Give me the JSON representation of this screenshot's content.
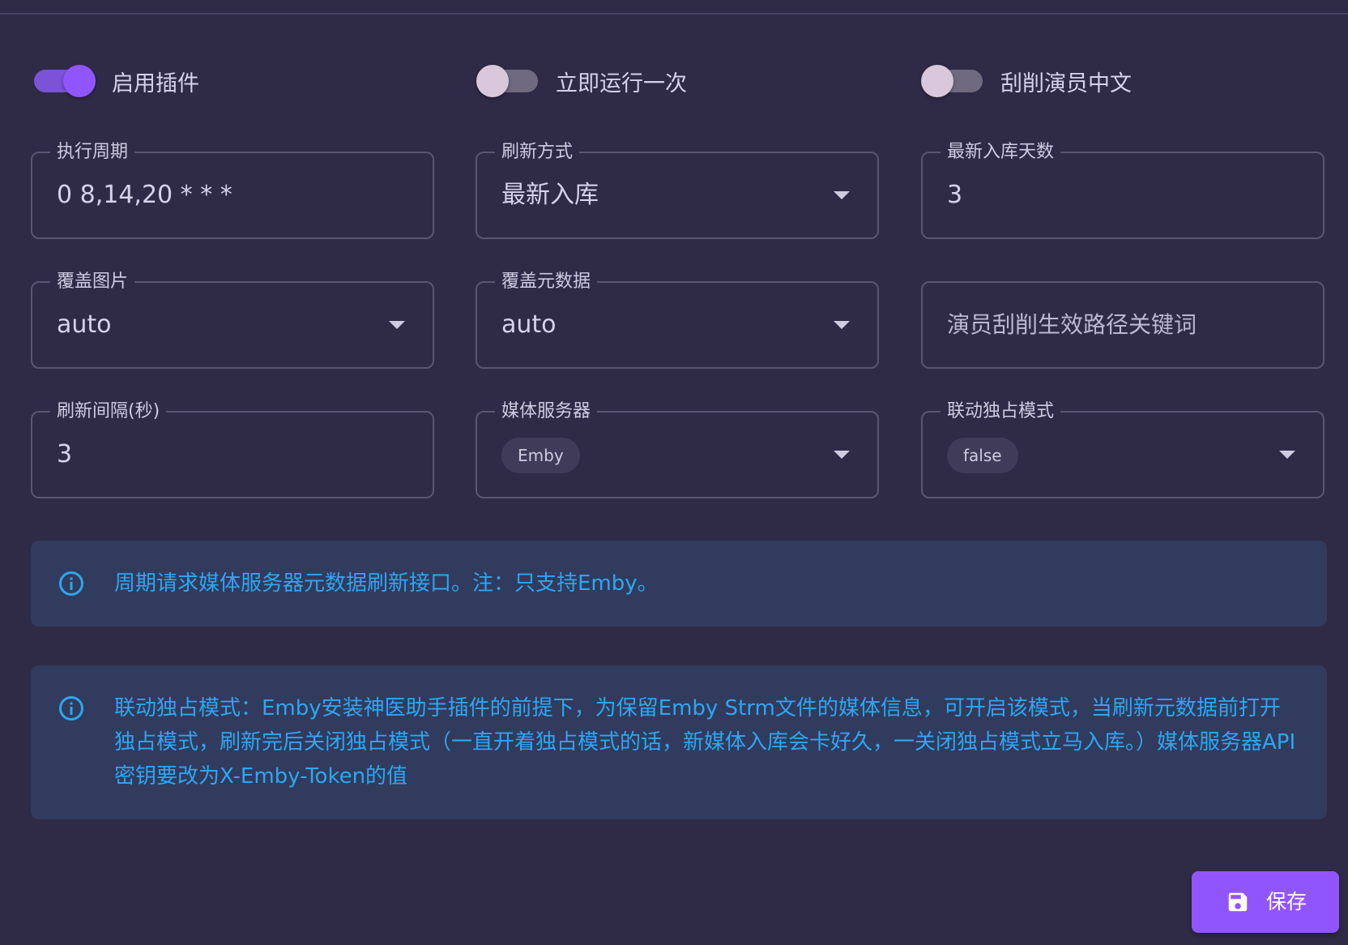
{
  "switches": [
    {
      "label": "启用插件",
      "on": true
    },
    {
      "label": "立即运行一次",
      "on": false
    },
    {
      "label": "刮削演员中文",
      "on": false
    }
  ],
  "fields": {
    "cron": {
      "label": "执行周期",
      "value": "0 8,14,20 * * *"
    },
    "refresh_mode": {
      "label": "刷新方式",
      "value": "最新入库"
    },
    "recent_days": {
      "label": "最新入库天数",
      "value": "3"
    },
    "overwrite_images": {
      "label": "覆盖图片",
      "value": "auto"
    },
    "overwrite_metadata": {
      "label": "覆盖元数据",
      "value": "auto"
    },
    "actor_paths": {
      "placeholder": "演员刮削生效路径关键词"
    },
    "refresh_interval": {
      "label": "刷新间隔(秒)",
      "value": "3"
    },
    "media_server": {
      "label": "媒体服务器",
      "value": "Emby"
    },
    "exclusive_mode": {
      "label": "联动独占模式",
      "value": "false"
    }
  },
  "alerts": [
    {
      "text": "周期请求媒体服务器元数据刷新接口。注：只支持Emby。"
    },
    {
      "text": "联动独占模式：Emby安装神医助手插件的前提下，为保留Emby Strm文件的媒体信息，可开启该模式，当刷新元数据前打开独占模式，刷新完后关闭独占模式（一直开着独占模式的话，新媒体入库会卡好久，一关闭独占模式立马入库。）媒体服务器API密钥要改为X-Emby-Token的值"
    }
  ],
  "save_button": {
    "label": "保存",
    "icon": "content-save-icon"
  },
  "colors": {
    "background": "#2f2b47",
    "primary": "#9155fd",
    "info_text": "#2ea6f0",
    "alert_bg": "#313b5e"
  }
}
